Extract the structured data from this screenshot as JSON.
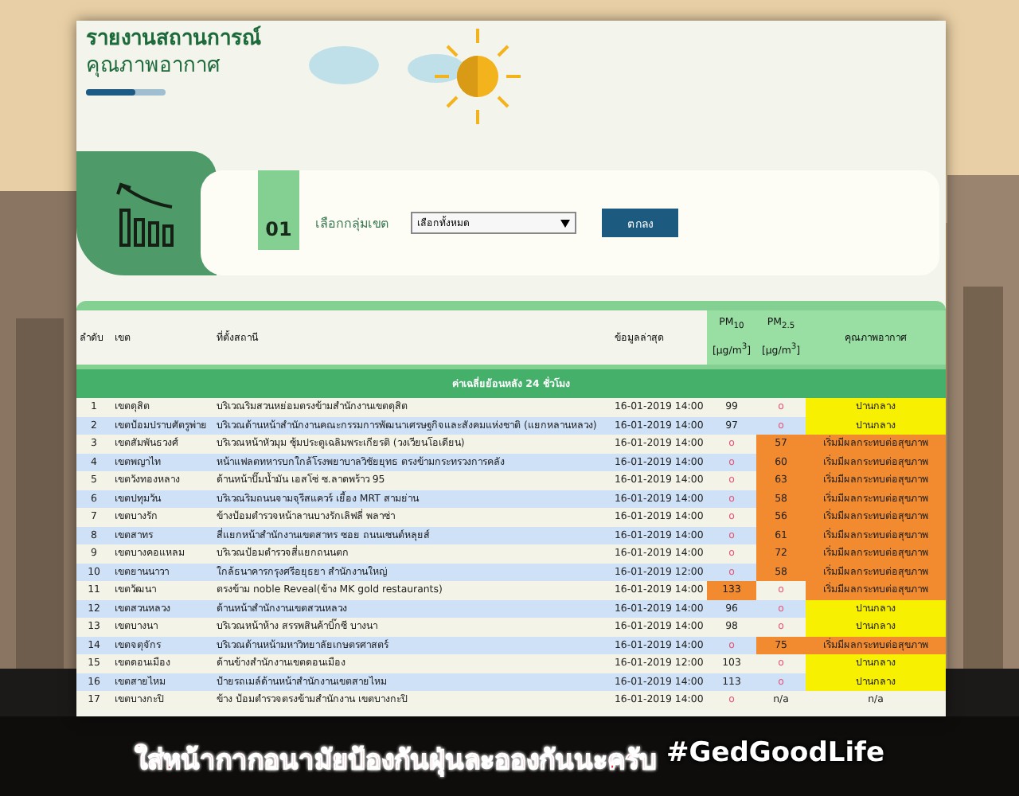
{
  "header": {
    "title": "รายงานสถานการณ์",
    "subtitle": "คุณภาพอากาศ",
    "progress": {
      "level": 0.62
    }
  },
  "filter": {
    "step": "01",
    "label": "เลือกกลุ่มเขต",
    "select_value": "เลือกทั้งหมด",
    "button": "ตกลง"
  },
  "table": {
    "columns": [
      "ลำดับ",
      "เขต",
      "ที่ตั้งสถานี",
      "ข้อมูลล่าสุด",
      "PM$_{10}$ [μg/m$^{3}$]",
      "PM$_{2.5}$ [μg/m$^{3}$]",
      "คุณภาพอากาศ"
    ],
    "band": "ค่าเฉลี่ยย้อนหลัง 24 ชั่วโมง",
    "rows": [
      {
        "no": "1",
        "district": "เขตดุสิต",
        "location": "บริเวณริมสวนหย่อมตรงข้ามสำนักงานเขตดุสิต",
        "time": "16-01-2019 14:00",
        "pm10": {
          "value": "99",
          "highlighted": false
        },
        "pm25": {
          "value": "o",
          "highlighted": false
        },
        "quality": "ปานกลาง",
        "color": "#f7f000"
      },
      {
        "no": "2",
        "district": "เขตป้อมปราบศัตรูพ่าย",
        "location": "บริเวณด้านหน้าสำนักงานคณะกรรมการพัฒนาเศรษฐกิจและสังคมแห่งชาติ (แยกหลานหลวง)",
        "time": "16-01-2019 14:00",
        "pm10": {
          "value": "97",
          "highlighted": false
        },
        "pm25": {
          "value": "o",
          "highlighted": false
        },
        "quality": "ปานกลาง",
        "color": "#f7f000"
      },
      {
        "no": "3",
        "district": "เขตสัมพันธวงศ์",
        "location": "บริเวณหน้าหัวมุม ซุ้มประตูเฉลิมพระเกียรติ (วงเวียนโอเดียน)",
        "time": "16-01-2019 14:00",
        "pm10": {
          "value": "o",
          "highlighted": false
        },
        "pm25": {
          "value": "57",
          "highlighted": true
        },
        "quality": "เริ่มมีผลกระทบต่อสุขภาพ",
        "color": "#f28a30"
      },
      {
        "no": "4",
        "district": "เขตพญาไท",
        "location": "หน้าแฟลตทหารบกใกล้โรงพยาบาลวิชัยยุทธ ตรงข้ามกระทรวงการคลัง",
        "time": "16-01-2019 14:00",
        "pm10": {
          "value": "o",
          "highlighted": false
        },
        "pm25": {
          "value": "60",
          "highlighted": true
        },
        "quality": "เริ่มมีผลกระทบต่อสุขภาพ",
        "color": "#f28a30"
      },
      {
        "no": "5",
        "district": "เขตวังทองหลาง",
        "location": "ด้านหน้าปั๊มน้ำมัน เอสโซ่ ซ.ลาดพร้าว 95",
        "time": "16-01-2019 14:00",
        "pm10": {
          "value": "o",
          "highlighted": false
        },
        "pm25": {
          "value": "63",
          "highlighted": true
        },
        "quality": "เริ่มมีผลกระทบต่อสุขภาพ",
        "color": "#f28a30"
      },
      {
        "no": "6",
        "district": "เขตปทุมวัน",
        "location": "บริเวณริมถนนจามจุรีสแควร์ เยื้อง MRT สามย่าน",
        "time": "16-01-2019 14:00",
        "pm10": {
          "value": "o",
          "highlighted": false
        },
        "pm25": {
          "value": "58",
          "highlighted": true
        },
        "quality": "เริ่มมีผลกระทบต่อสุขภาพ",
        "color": "#f28a30"
      },
      {
        "no": "7",
        "district": "เขตบางรัก",
        "location": "ข้างป้อมตำรวจหน้าลานบางรักเลิฟลี่ พลาซ่า",
        "time": "16-01-2019 14:00",
        "pm10": {
          "value": "o",
          "highlighted": false
        },
        "pm25": {
          "value": "56",
          "highlighted": true
        },
        "quality": "เริ่มมีผลกระทบต่อสุขภาพ",
        "color": "#f28a30"
      },
      {
        "no": "8",
        "district": "เขตสาทร",
        "location": "สี่แยกหน้าสำนักงานเขตสาทร ซอย ถนนเซนต์หลุยส์",
        "time": "16-01-2019 14:00",
        "pm10": {
          "value": "o",
          "highlighted": false
        },
        "pm25": {
          "value": "61",
          "highlighted": true
        },
        "quality": "เริ่มมีผลกระทบต่อสุขภาพ",
        "color": "#f28a30"
      },
      {
        "no": "9",
        "district": "เขตบางคอแหลม",
        "location": "บริเวณป้อมตำรวจสี่แยกถนนตก",
        "time": "16-01-2019 14:00",
        "pm10": {
          "value": "o",
          "highlighted": false
        },
        "pm25": {
          "value": "72",
          "highlighted": true
        },
        "quality": "เริ่มมีผลกระทบต่อสุขภาพ",
        "color": "#f28a30"
      },
      {
        "no": "10",
        "district": "เขตยานนาวา",
        "location": "ใกล้ธนาคารกรุงศรีอยุธยา สำนักงานใหญ่",
        "time": "16-01-2019 12:00",
        "pm10": {
          "value": "o",
          "highlighted": false
        },
        "pm25": {
          "value": "58",
          "highlighted": true
        },
        "quality": "เริ่มมีผลกระทบต่อสุขภาพ",
        "color": "#f28a30"
      },
      {
        "no": "11",
        "district": "เขตวัฒนา",
        "location": "ตรงข้าม noble Reveal(ข้าง MK gold restaurants)",
        "time": "16-01-2019 14:00",
        "pm10": {
          "value": "133",
          "highlighted": true
        },
        "pm25": {
          "value": "o",
          "highlighted": false
        },
        "quality": "เริ่มมีผลกระทบต่อสุขภาพ",
        "color": "#f28a30"
      },
      {
        "no": "12",
        "district": "เขตสวนหลวง",
        "location": "ด้านหน้าสำนักงานเขตสวนหลวง",
        "time": "16-01-2019 14:00",
        "pm10": {
          "value": "96",
          "highlighted": false
        },
        "pm25": {
          "value": "o",
          "highlighted": false
        },
        "quality": "ปานกลาง",
        "color": "#f7f000"
      },
      {
        "no": "13",
        "district": "เขตบางนา",
        "location": "บริเวณหน้าห้าง สรรพสินค้าบิ๊กซี บางนา",
        "time": "16-01-2019 14:00",
        "pm10": {
          "value": "98",
          "highlighted": false
        },
        "pm25": {
          "value": "o",
          "highlighted": false
        },
        "quality": "ปานกลาง",
        "color": "#f7f000"
      },
      {
        "no": "14",
        "district": "เขตจตุจักร",
        "location": "บริเวณด้านหน้ามหาวิทยาลัยเกษตรศาสตร์",
        "time": "16-01-2019 14:00",
        "pm10": {
          "value": "o",
          "highlighted": false
        },
        "pm25": {
          "value": "75",
          "highlighted": true
        },
        "quality": "เริ่มมีผลกระทบต่อสุขภาพ",
        "color": "#f28a30"
      },
      {
        "no": "15",
        "district": "เขตดอนเมือง",
        "location": "ด้านข้างสำนักงานเขตดอนเมือง",
        "time": "16-01-2019 12:00",
        "pm10": {
          "value": "103",
          "highlighted": false
        },
        "pm25": {
          "value": "o",
          "highlighted": false
        },
        "quality": "ปานกลาง",
        "color": "#f7f000"
      },
      {
        "no": "16",
        "district": "เขตสายไหม",
        "location": "ป้ายรถเมล์ด้านหน้าสำนักงานเขตสายไหม",
        "time": "16-01-2019 14:00",
        "pm10": {
          "value": "113",
          "highlighted": false
        },
        "pm25": {
          "value": "o",
          "highlighted": false
        },
        "quality": "ปานกลาง",
        "color": "#f7f000"
      },
      {
        "no": "17",
        "district": "เขตบางกะปิ",
        "location": "ข้าง ป้อมตำรวจตรงข้ามสำนักงาน เขตบางกะปิ",
        "time": "16-01-2019 14:00",
        "pm10": {
          "value": "o",
          "highlighted": false
        },
        "pm25": {
          "value": "n/a",
          "highlighted": false
        },
        "quality": "n/a",
        "color": "#f4f3e8"
      }
    ]
  },
  "caption": {
    "message": "ใส่หน้ากากอนามัยป้องกันฝุ่นละอองกันนะครับ",
    "hashtag": "#GedGoodLife"
  }
}
